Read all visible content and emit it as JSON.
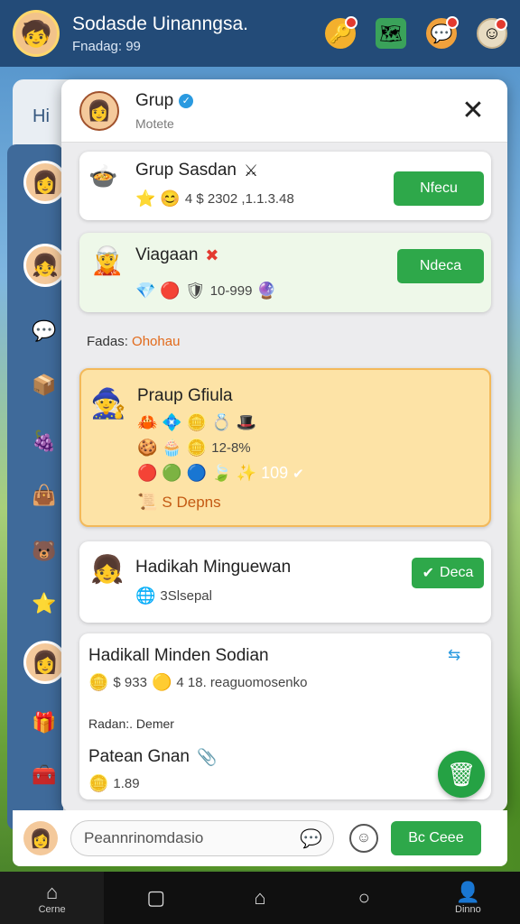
{
  "topbar": {
    "title": "Sodasde Uinanngsa.",
    "subtitle": "Fnadag: 99"
  },
  "back_panel": {
    "label": "Hi"
  },
  "modal": {
    "title": "Grup",
    "subtitle": "Motete",
    "cards": [
      {
        "title": "Grup Sasdan",
        "meta": "4 $ 2302 ,1.1.3.48",
        "button": "Nfecu"
      },
      {
        "title": "Viagaan",
        "meta": "10-999",
        "button": "Ndeca"
      },
      {
        "title": "Praup Gfiula",
        "row2": "12-8%",
        "row3": "109",
        "footer": "S Depns"
      },
      {
        "title": "Hadikah Minguewan",
        "meta": "3Slsepal",
        "button": "Deca"
      },
      {
        "title": "Hadikall Minden Sodian",
        "meta": "$ 933",
        "meta2": "4 18. reaguomosenko",
        "label": "Radan:. Demer",
        "sub_title": "Patean Gnan",
        "sub_meta": "1.89"
      }
    ],
    "section_label": "Fadas:",
    "section_value": "Ohohau"
  },
  "compose": {
    "placeholder": "Peannrinomdasio",
    "send": "Bc Ceee"
  },
  "nav": {
    "items": [
      "Cerne",
      "",
      "",
      "",
      "Dinno"
    ]
  }
}
